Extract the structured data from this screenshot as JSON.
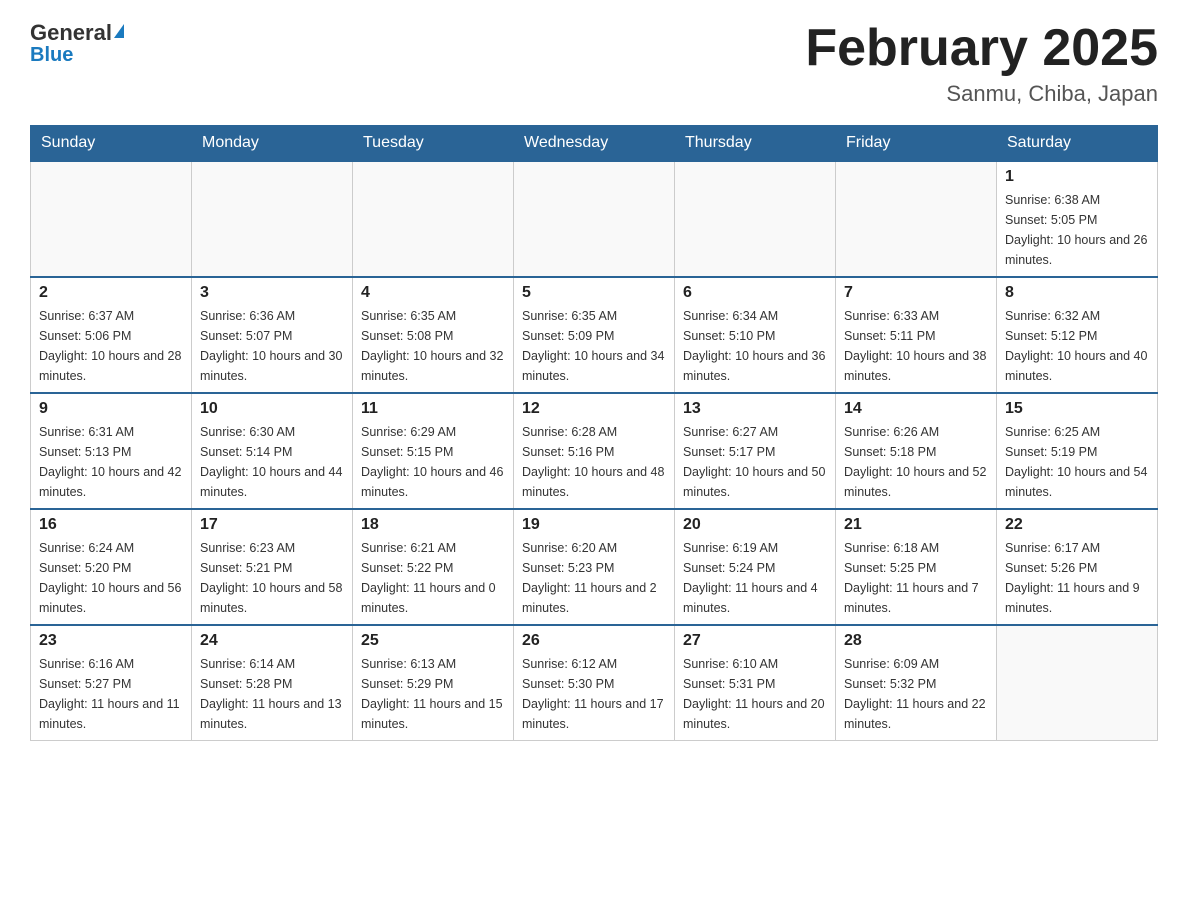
{
  "header": {
    "logo_general": "General",
    "logo_blue": "Blue",
    "month_title": "February 2025",
    "location": "Sanmu, Chiba, Japan"
  },
  "days_of_week": [
    "Sunday",
    "Monday",
    "Tuesday",
    "Wednesday",
    "Thursday",
    "Friday",
    "Saturday"
  ],
  "weeks": [
    [
      {
        "day": "",
        "sunrise": "",
        "sunset": "",
        "daylight": ""
      },
      {
        "day": "",
        "sunrise": "",
        "sunset": "",
        "daylight": ""
      },
      {
        "day": "",
        "sunrise": "",
        "sunset": "",
        "daylight": ""
      },
      {
        "day": "",
        "sunrise": "",
        "sunset": "",
        "daylight": ""
      },
      {
        "day": "",
        "sunrise": "",
        "sunset": "",
        "daylight": ""
      },
      {
        "day": "",
        "sunrise": "",
        "sunset": "",
        "daylight": ""
      },
      {
        "day": "1",
        "sunrise": "Sunrise: 6:38 AM",
        "sunset": "Sunset: 5:05 PM",
        "daylight": "Daylight: 10 hours and 26 minutes."
      }
    ],
    [
      {
        "day": "2",
        "sunrise": "Sunrise: 6:37 AM",
        "sunset": "Sunset: 5:06 PM",
        "daylight": "Daylight: 10 hours and 28 minutes."
      },
      {
        "day": "3",
        "sunrise": "Sunrise: 6:36 AM",
        "sunset": "Sunset: 5:07 PM",
        "daylight": "Daylight: 10 hours and 30 minutes."
      },
      {
        "day": "4",
        "sunrise": "Sunrise: 6:35 AM",
        "sunset": "Sunset: 5:08 PM",
        "daylight": "Daylight: 10 hours and 32 minutes."
      },
      {
        "day": "5",
        "sunrise": "Sunrise: 6:35 AM",
        "sunset": "Sunset: 5:09 PM",
        "daylight": "Daylight: 10 hours and 34 minutes."
      },
      {
        "day": "6",
        "sunrise": "Sunrise: 6:34 AM",
        "sunset": "Sunset: 5:10 PM",
        "daylight": "Daylight: 10 hours and 36 minutes."
      },
      {
        "day": "7",
        "sunrise": "Sunrise: 6:33 AM",
        "sunset": "Sunset: 5:11 PM",
        "daylight": "Daylight: 10 hours and 38 minutes."
      },
      {
        "day": "8",
        "sunrise": "Sunrise: 6:32 AM",
        "sunset": "Sunset: 5:12 PM",
        "daylight": "Daylight: 10 hours and 40 minutes."
      }
    ],
    [
      {
        "day": "9",
        "sunrise": "Sunrise: 6:31 AM",
        "sunset": "Sunset: 5:13 PM",
        "daylight": "Daylight: 10 hours and 42 minutes."
      },
      {
        "day": "10",
        "sunrise": "Sunrise: 6:30 AM",
        "sunset": "Sunset: 5:14 PM",
        "daylight": "Daylight: 10 hours and 44 minutes."
      },
      {
        "day": "11",
        "sunrise": "Sunrise: 6:29 AM",
        "sunset": "Sunset: 5:15 PM",
        "daylight": "Daylight: 10 hours and 46 minutes."
      },
      {
        "day": "12",
        "sunrise": "Sunrise: 6:28 AM",
        "sunset": "Sunset: 5:16 PM",
        "daylight": "Daylight: 10 hours and 48 minutes."
      },
      {
        "day": "13",
        "sunrise": "Sunrise: 6:27 AM",
        "sunset": "Sunset: 5:17 PM",
        "daylight": "Daylight: 10 hours and 50 minutes."
      },
      {
        "day": "14",
        "sunrise": "Sunrise: 6:26 AM",
        "sunset": "Sunset: 5:18 PM",
        "daylight": "Daylight: 10 hours and 52 minutes."
      },
      {
        "day": "15",
        "sunrise": "Sunrise: 6:25 AM",
        "sunset": "Sunset: 5:19 PM",
        "daylight": "Daylight: 10 hours and 54 minutes."
      }
    ],
    [
      {
        "day": "16",
        "sunrise": "Sunrise: 6:24 AM",
        "sunset": "Sunset: 5:20 PM",
        "daylight": "Daylight: 10 hours and 56 minutes."
      },
      {
        "day": "17",
        "sunrise": "Sunrise: 6:23 AM",
        "sunset": "Sunset: 5:21 PM",
        "daylight": "Daylight: 10 hours and 58 minutes."
      },
      {
        "day": "18",
        "sunrise": "Sunrise: 6:21 AM",
        "sunset": "Sunset: 5:22 PM",
        "daylight": "Daylight: 11 hours and 0 minutes."
      },
      {
        "day": "19",
        "sunrise": "Sunrise: 6:20 AM",
        "sunset": "Sunset: 5:23 PM",
        "daylight": "Daylight: 11 hours and 2 minutes."
      },
      {
        "day": "20",
        "sunrise": "Sunrise: 6:19 AM",
        "sunset": "Sunset: 5:24 PM",
        "daylight": "Daylight: 11 hours and 4 minutes."
      },
      {
        "day": "21",
        "sunrise": "Sunrise: 6:18 AM",
        "sunset": "Sunset: 5:25 PM",
        "daylight": "Daylight: 11 hours and 7 minutes."
      },
      {
        "day": "22",
        "sunrise": "Sunrise: 6:17 AM",
        "sunset": "Sunset: 5:26 PM",
        "daylight": "Daylight: 11 hours and 9 minutes."
      }
    ],
    [
      {
        "day": "23",
        "sunrise": "Sunrise: 6:16 AM",
        "sunset": "Sunset: 5:27 PM",
        "daylight": "Daylight: 11 hours and 11 minutes."
      },
      {
        "day": "24",
        "sunrise": "Sunrise: 6:14 AM",
        "sunset": "Sunset: 5:28 PM",
        "daylight": "Daylight: 11 hours and 13 minutes."
      },
      {
        "day": "25",
        "sunrise": "Sunrise: 6:13 AM",
        "sunset": "Sunset: 5:29 PM",
        "daylight": "Daylight: 11 hours and 15 minutes."
      },
      {
        "day": "26",
        "sunrise": "Sunrise: 6:12 AM",
        "sunset": "Sunset: 5:30 PM",
        "daylight": "Daylight: 11 hours and 17 minutes."
      },
      {
        "day": "27",
        "sunrise": "Sunrise: 6:10 AM",
        "sunset": "Sunset: 5:31 PM",
        "daylight": "Daylight: 11 hours and 20 minutes."
      },
      {
        "day": "28",
        "sunrise": "Sunrise: 6:09 AM",
        "sunset": "Sunset: 5:32 PM",
        "daylight": "Daylight: 11 hours and 22 minutes."
      },
      {
        "day": "",
        "sunrise": "",
        "sunset": "",
        "daylight": ""
      }
    ]
  ]
}
